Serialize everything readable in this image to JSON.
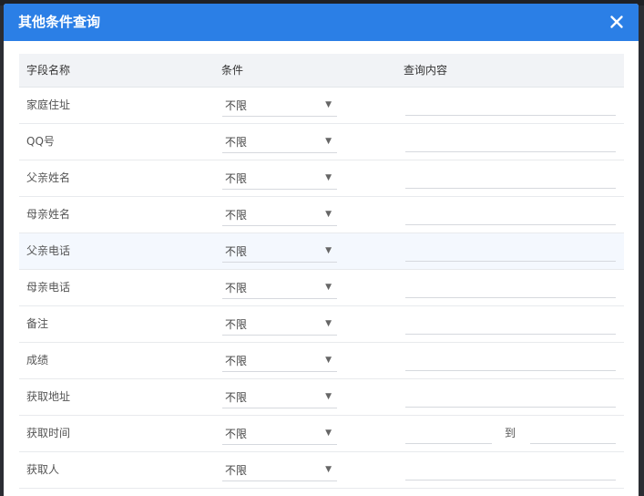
{
  "dialog": {
    "title": "其他条件查询",
    "close_icon": "close-icon"
  },
  "table": {
    "headers": [
      "字段名称",
      "条件",
      "查询内容"
    ],
    "rows": [
      {
        "label": "家庭住址",
        "condition": "不限",
        "type": "text",
        "value": ""
      },
      {
        "label": "QQ号",
        "condition": "不限",
        "type": "text",
        "value": ""
      },
      {
        "label": "父亲姓名",
        "condition": "不限",
        "type": "text",
        "value": ""
      },
      {
        "label": "母亲姓名",
        "condition": "不限",
        "type": "text",
        "value": ""
      },
      {
        "label": "父亲电话",
        "condition": "不限",
        "type": "text",
        "value": "",
        "highlighted": true
      },
      {
        "label": "母亲电话",
        "condition": "不限",
        "type": "text",
        "value": ""
      },
      {
        "label": "备注",
        "condition": "不限",
        "type": "text",
        "value": ""
      },
      {
        "label": "成绩",
        "condition": "不限",
        "type": "text",
        "value": ""
      },
      {
        "label": "获取地址",
        "condition": "不限",
        "type": "text",
        "value": ""
      },
      {
        "label": "获取时间",
        "condition": "不限",
        "type": "range",
        "range_separator": "到",
        "value_from": "",
        "value_to": ""
      },
      {
        "label": "获取人",
        "condition": "不限",
        "type": "text",
        "value": ""
      }
    ]
  },
  "colors": {
    "header_blue": "#2b7fe6",
    "row_highlight": "#f4f8fe"
  }
}
